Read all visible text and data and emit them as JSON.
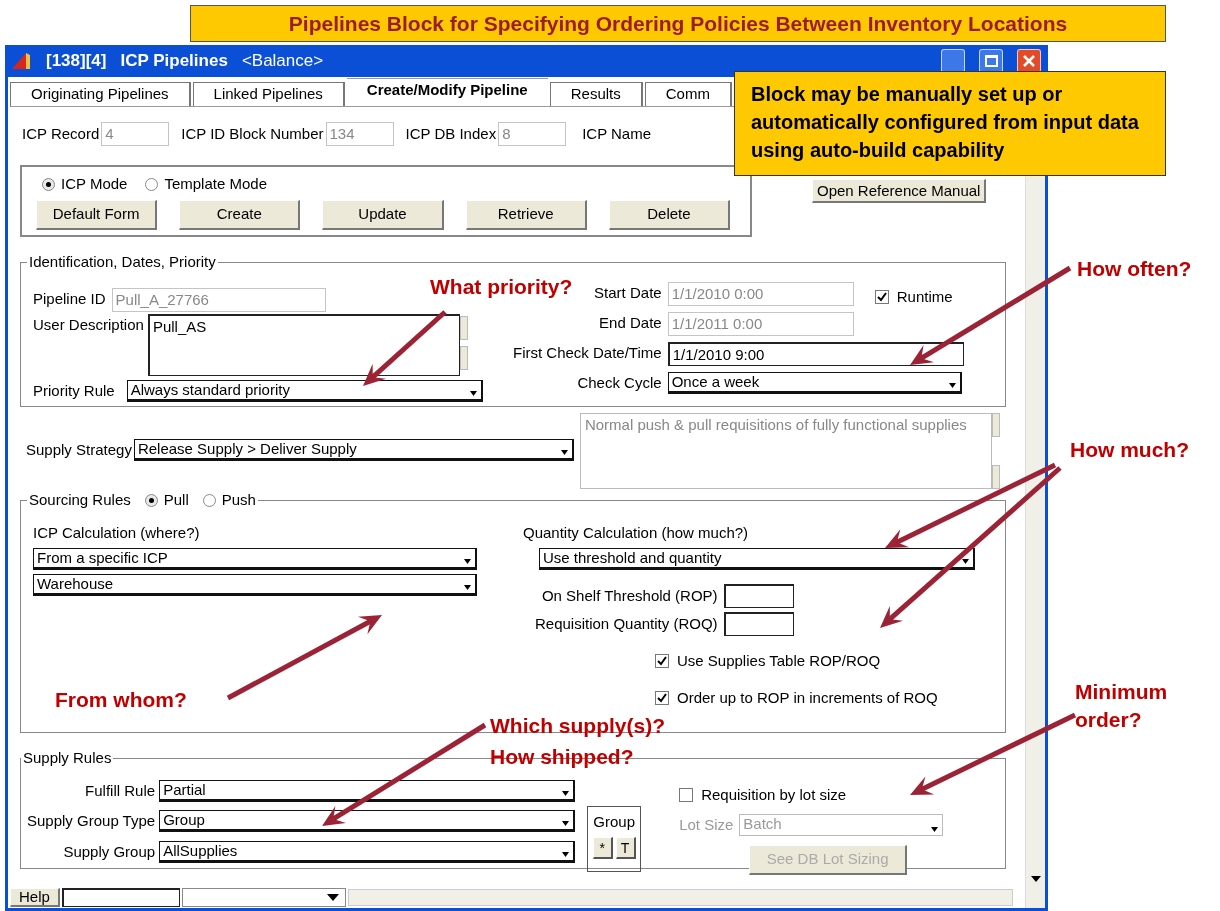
{
  "banner": "Pipelines Block for Specifying Ordering Policies Between Inventory Locations",
  "window": {
    "id": "[138][4]",
    "title": "ICP Pipelines",
    "scenario": "<Balance>"
  },
  "tabs": [
    {
      "label": "Originating Pipelines",
      "selected": false
    },
    {
      "label": "Linked Pipelines",
      "selected": false
    },
    {
      "label": "Create/Modify Pipeline",
      "selected": true
    },
    {
      "label": "Results",
      "selected": false
    },
    {
      "label": "Comm",
      "selected": false
    }
  ],
  "record_fields": [
    {
      "label": "ICP Record",
      "value": "4",
      "disabled": true
    },
    {
      "label": "ICP ID Block Number",
      "value": "134",
      "disabled": true
    },
    {
      "label": "ICP DB Index",
      "value": "8",
      "disabled": true
    }
  ],
  "icp_name_label": "ICP Name",
  "modes": [
    {
      "label": "ICP Mode",
      "selected": true
    },
    {
      "label": "Template Mode",
      "selected": false
    }
  ],
  "action_buttons": [
    "Default Form",
    "Create",
    "Update",
    "Retrieve",
    "Delete"
  ],
  "reference_button": "Open Reference Manual",
  "identification": {
    "legend": "Identification, Dates, Priority",
    "pipeline_id": {
      "label": "Pipeline ID",
      "value": "Pull_A_27766",
      "disabled": true
    },
    "user_description": {
      "label": "User Description",
      "value": "Pull_AS"
    },
    "priority_rule": {
      "label": "Priority Rule",
      "value": "Always standard priority"
    },
    "start_date": {
      "label": "Start Date",
      "value": "1/1/2010 0:00",
      "disabled": true
    },
    "end_date": {
      "label": "End Date",
      "value": "1/1/2011 0:00",
      "disabled": true
    },
    "first_check": {
      "label": "First Check Date/Time",
      "value": "1/1/2010 9:00",
      "disabled": false
    },
    "check_cycle": {
      "label": "Check Cycle",
      "value": "Once a week"
    },
    "runtime": {
      "label": "Runtime",
      "checked": true
    }
  },
  "supply_strategy": {
    "label": "Supply Strategy",
    "value": "Release Supply > Deliver Supply",
    "description": "Normal push & pull requisitions of fully functional supplies"
  },
  "sourcing": {
    "legend": "Sourcing Rules",
    "options": [
      {
        "label": "Pull",
        "selected": true
      },
      {
        "label": "Push",
        "selected": false
      }
    ],
    "icp_calc_label": "ICP Calculation (where?)",
    "icp_calc_values": [
      "From a specific ICP",
      "Warehouse"
    ],
    "qty_label": "Quantity Calculation (how much?)",
    "qty_value": "Use threshold and quantity",
    "rop_label": "On Shelf Threshold (ROP)",
    "roq_label": "Requisition Quantity (ROQ)",
    "checks": [
      {
        "label": "Use Supplies Table ROP/ROQ",
        "checked": true
      },
      {
        "label": "Order up to ROP in increments of ROQ",
        "checked": true
      }
    ]
  },
  "supply_rules": {
    "legend": "Supply Rules",
    "fulfill": {
      "label": "Fulfill Rule",
      "value": "Partial"
    },
    "group_type": {
      "label": "Supply Group Type",
      "value": "Group"
    },
    "group": {
      "label": "Supply Group",
      "value": "AllSupplies"
    },
    "group_box": {
      "label": "Group",
      "buttons": [
        "*",
        "T"
      ]
    },
    "lot_check": {
      "label": "Requisition by lot size",
      "checked": false
    },
    "lot_size": {
      "label": "Lot Size",
      "value": "Batch",
      "disabled": true
    },
    "lot_button": {
      "label": "See DB Lot Sizing",
      "disabled": true
    }
  },
  "status_bar": {
    "help": "Help"
  },
  "callout": "Block may be manually set up or automatically configured from input data using auto-build capability",
  "annotations": [
    "What priority?",
    "How often?",
    "How much?",
    "From whom?",
    "Which supply(s)?",
    "How shipped?",
    "Minimum order?"
  ]
}
